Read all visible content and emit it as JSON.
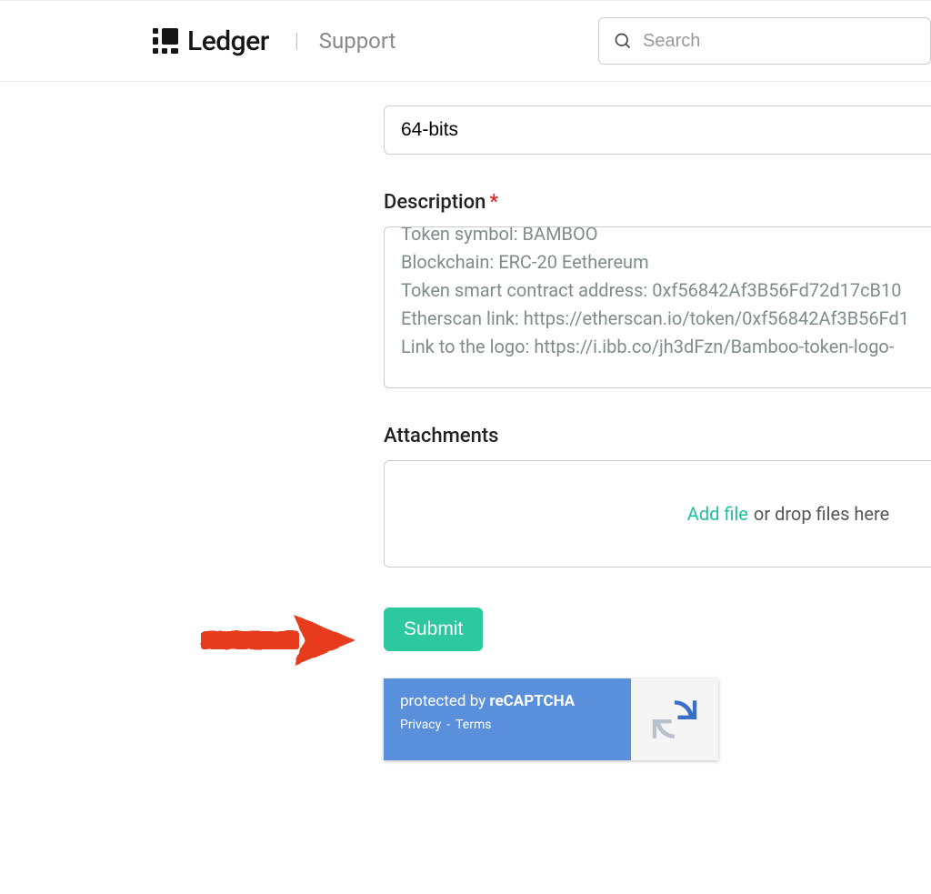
{
  "header": {
    "brand": "Ledger",
    "section": "Support",
    "search_placeholder": "Search"
  },
  "form": {
    "field_value": "64-bits",
    "description_label": "Description",
    "description_lines": [
      "Token symbol: BAMBOO",
      "Blockchain: ERC-20 Eethereum",
      "Token smart contract address:  0xf56842Af3B56Fd72d17cB10",
      "Etherscan link: https://etherscan.io/token/0xf56842Af3B56Fd1",
      "Link to the logo: https://i.ibb.co/jh3dFzn/Bamboo-token-logo-"
    ],
    "attachments_label": "Attachments",
    "add_file": "Add file",
    "drop_hint": "or drop files here",
    "submit_label": "Submit"
  },
  "recaptcha": {
    "protected": "protected by",
    "name": "reCAPTCHA",
    "privacy": "Privacy",
    "terms": "Terms"
  }
}
